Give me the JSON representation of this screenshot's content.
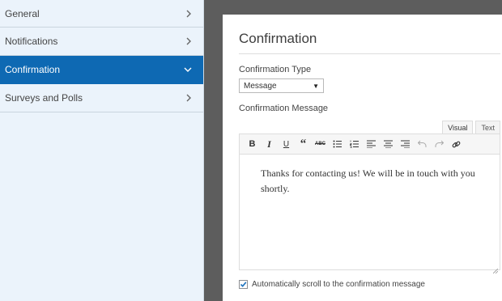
{
  "sidebar": {
    "items": [
      {
        "label": "General",
        "icon": "chevron-right-icon"
      },
      {
        "label": "Notifications",
        "icon": "chevron-right-icon"
      },
      {
        "label": "Confirmation",
        "icon": "chevron-down-icon",
        "active": true
      },
      {
        "label": "Surveys and Polls",
        "icon": "chevron-right-icon"
      }
    ]
  },
  "panel": {
    "title": "Confirmation",
    "type_label": "Confirmation Type",
    "type_value": "Message",
    "message_label": "Confirmation Message",
    "tabs": {
      "visual": "Visual",
      "text": "Text",
      "active": "Visual"
    },
    "toolbar": [
      "bold-icon",
      "italic-icon",
      "underline-icon",
      "blockquote-icon",
      "strikethrough-icon",
      "bullet-list-icon",
      "numbered-list-icon",
      "align-left-icon",
      "align-center-icon",
      "align-right-icon",
      "undo-icon",
      "redo-icon",
      "link-icon"
    ],
    "message_text": "Thanks for contacting us! We will be in touch with you shortly.",
    "auto_scroll_label": "Automatically scroll to the confirmation message",
    "auto_scroll_checked": true
  },
  "colors": {
    "accent": "#0e69b3",
    "sidebar_bg": "#ebf3fb",
    "backdrop": "#5d5d5d"
  }
}
